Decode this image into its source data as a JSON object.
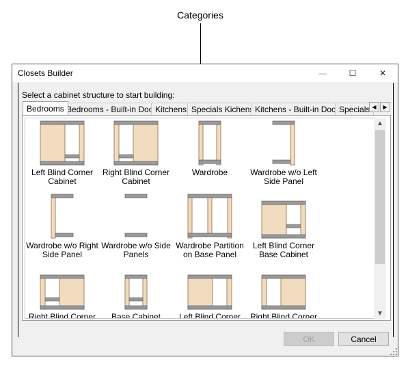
{
  "annotation": {
    "label": "Categories"
  },
  "window": {
    "title": "Closets Builder",
    "minimize_glyph": "—",
    "maximize_glyph": "☐",
    "close_glyph": "✕"
  },
  "prompt": "Select a cabinet structure to start building:",
  "tabs": [
    {
      "label": "Bedrooms",
      "active": true
    },
    {
      "label": "Bedrooms - Built-in Doors",
      "active": false
    },
    {
      "label": "Kitchens",
      "active": false
    },
    {
      "label": "Specials Kichens",
      "active": false
    },
    {
      "label": "Kitchens - Built-in Doors",
      "active": false
    },
    {
      "label": "Specials",
      "active": false
    }
  ],
  "tab_scroll": {
    "left_glyph": "◀",
    "right_glyph": "▶"
  },
  "items": [
    {
      "label": "Left Blind Corner Cabinet",
      "icon": "left-blind-corner-cabinet-icon"
    },
    {
      "label": "Right Blind Corner Cabinet",
      "icon": "right-blind-corner-cabinet-icon"
    },
    {
      "label": "Wardrobe",
      "icon": "wardrobe-icon"
    },
    {
      "label": "Wardrobe w/o Left Side Panel",
      "icon": "wardrobe-no-left-panel-icon"
    },
    {
      "label": "Wardrobe w/o Right Side Panel",
      "icon": "wardrobe-no-right-panel-icon"
    },
    {
      "label": "Wardrobe w/o Side Panels",
      "icon": "wardrobe-no-side-panels-icon"
    },
    {
      "label": "Wardrobe Partition on Base Panel",
      "icon": "wardrobe-partition-icon"
    },
    {
      "label": "Left Blind Corner Base Cabinet",
      "icon": "left-blind-corner-base-cabinet-icon"
    },
    {
      "label": "Right Blind Corner Base Cabinet",
      "icon": "right-blind-corner-base-cabinet-icon"
    },
    {
      "label": "Base Cabinet",
      "icon": "base-cabinet-icon"
    },
    {
      "label": "Left Blind Corner Wall Cabinet",
      "icon": "left-blind-corner-wall-cabinet-icon"
    },
    {
      "label": "Right Blind Corner Wall Cabinet",
      "icon": "right-blind-corner-wall-cabinet-icon"
    }
  ],
  "scrollbar": {
    "up_glyph": "▲",
    "down_glyph": "▼"
  },
  "buttons": {
    "ok": "OK",
    "cancel": "Cancel"
  },
  "colors": {
    "wood": "#f1dcc0",
    "wood_edge": "#8a6a46",
    "metal": "#9a9a9a",
    "window_bg": "#f0f0f0"
  }
}
